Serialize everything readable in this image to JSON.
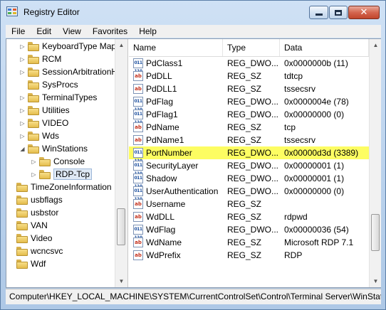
{
  "window": {
    "title": "Registry Editor"
  },
  "menu": [
    "File",
    "Edit",
    "View",
    "Favorites",
    "Help"
  ],
  "tree": [
    {
      "label": "KeyboardType Mapp",
      "indent": 1,
      "expand": "▷"
    },
    {
      "label": "RCM",
      "indent": 1,
      "expand": "▷"
    },
    {
      "label": "SessionArbitrationH",
      "indent": 1,
      "expand": "▷"
    },
    {
      "label": "SysProcs",
      "indent": 1,
      "expand": ""
    },
    {
      "label": "TerminalTypes",
      "indent": 1,
      "expand": "▷"
    },
    {
      "label": "Utilities",
      "indent": 1,
      "expand": "▷"
    },
    {
      "label": "VIDEO",
      "indent": 1,
      "expand": "▷"
    },
    {
      "label": "Wds",
      "indent": 1,
      "expand": "▷"
    },
    {
      "label": "WinStations",
      "indent": 1,
      "expand": "◢"
    },
    {
      "label": "Console",
      "indent": 2,
      "expand": "▷"
    },
    {
      "label": "RDP-Tcp",
      "indent": 2,
      "expand": "▷",
      "selected": true
    },
    {
      "label": "TimeZoneInformation",
      "indent": 0,
      "expand": ""
    },
    {
      "label": "usbflags",
      "indent": 0,
      "expand": ""
    },
    {
      "label": "usbstor",
      "indent": 0,
      "expand": ""
    },
    {
      "label": "VAN",
      "indent": 0,
      "expand": ""
    },
    {
      "label": "Video",
      "indent": 0,
      "expand": ""
    },
    {
      "label": "wcncsvc",
      "indent": 0,
      "expand": ""
    },
    {
      "label": "Wdf",
      "indent": 0,
      "expand": ""
    }
  ],
  "columns": {
    "name": "Name",
    "type": "Type",
    "data": "Data"
  },
  "values": [
    {
      "name": "PdClass1",
      "type": "REG_DWO...",
      "data": "0x0000000b (11)",
      "kind": "bin"
    },
    {
      "name": "PdDLL",
      "type": "REG_SZ",
      "data": "tdtcp",
      "kind": "sz"
    },
    {
      "name": "PdDLL1",
      "type": "REG_SZ",
      "data": "tssecsrv",
      "kind": "sz"
    },
    {
      "name": "PdFlag",
      "type": "REG_DWO...",
      "data": "0x0000004e (78)",
      "kind": "bin"
    },
    {
      "name": "PdFlag1",
      "type": "REG_DWO...",
      "data": "0x00000000 (0)",
      "kind": "bin"
    },
    {
      "name": "PdName",
      "type": "REG_SZ",
      "data": "tcp",
      "kind": "sz"
    },
    {
      "name": "PdName1",
      "type": "REG_SZ",
      "data": "tssecsrv",
      "kind": "sz"
    },
    {
      "name": "PortNumber",
      "type": "REG_DWO...",
      "data": "0x00000d3d (3389)",
      "kind": "bin",
      "highlight": true
    },
    {
      "name": "SecurityLayer",
      "type": "REG_DWO...",
      "data": "0x00000001 (1)",
      "kind": "bin"
    },
    {
      "name": "Shadow",
      "type": "REG_DWO...",
      "data": "0x00000001 (1)",
      "kind": "bin"
    },
    {
      "name": "UserAuthentication",
      "type": "REG_DWO...",
      "data": "0x00000000 (0)",
      "kind": "bin"
    },
    {
      "name": "Username",
      "type": "REG_SZ",
      "data": "",
      "kind": "sz"
    },
    {
      "name": "WdDLL",
      "type": "REG_SZ",
      "data": "rdpwd",
      "kind": "sz"
    },
    {
      "name": "WdFlag",
      "type": "REG_DWO...",
      "data": "0x00000036 (54)",
      "kind": "bin"
    },
    {
      "name": "WdName",
      "type": "REG_SZ",
      "data": "Microsoft RDP 7.1",
      "kind": "sz"
    },
    {
      "name": "WdPrefix",
      "type": "REG_SZ",
      "data": "RDP",
      "kind": "sz"
    }
  ],
  "status": {
    "path": "Computer\\HKEY_LOCAL_MACHINE\\SYSTEM\\CurrentControlSet\\Control\\Terminal Server\\WinStations\\RDP-Tcp"
  },
  "icons": {
    "sz": "ab",
    "bin": "011\n110"
  }
}
